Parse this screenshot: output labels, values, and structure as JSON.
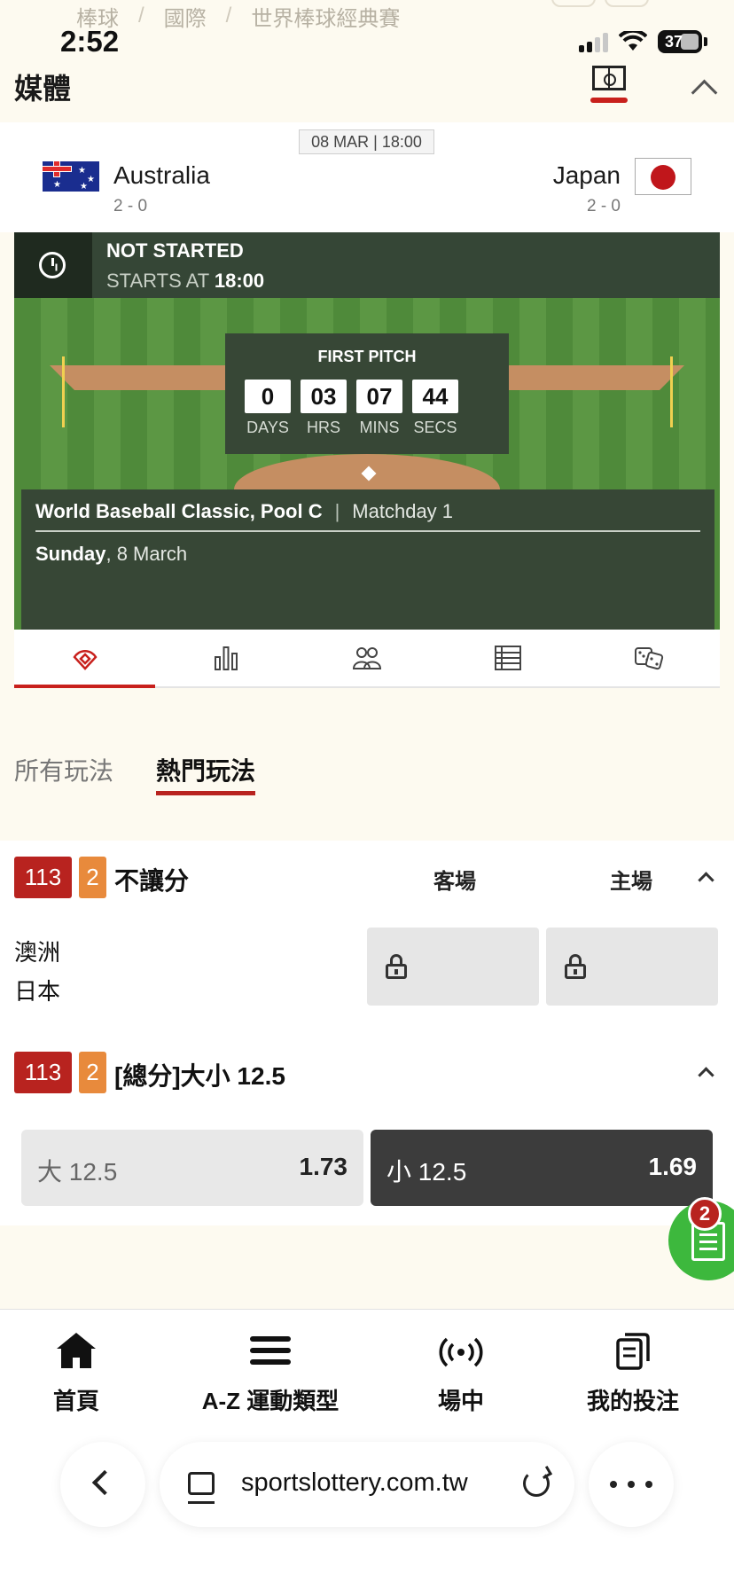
{
  "breadcrumb": [
    "棒球",
    "國際",
    "世界棒球經典賽"
  ],
  "status_bar": {
    "time": "2:52",
    "battery": "37"
  },
  "media": {
    "title": "媒體"
  },
  "match": {
    "date": "08 MAR | 18:00",
    "home": {
      "name": "Australia",
      "score": "2 - 0"
    },
    "away": {
      "name": "Japan",
      "score": "2 - 0"
    },
    "status": "NOT STARTED",
    "starts_at_label": "STARTS AT",
    "starts_at_time": "18:00",
    "first_pitch_label": "FIRST PITCH",
    "countdown": [
      {
        "value": "0",
        "unit": "DAYS"
      },
      {
        "value": "03",
        "unit": "HRS"
      },
      {
        "value": "07",
        "unit": "MINS"
      },
      {
        "value": "44",
        "unit": "SECS"
      }
    ],
    "competition": "World Baseball Classic, Pool C",
    "matchday": "Matchday 1",
    "day": "Sunday",
    "date_long": ", 8 March"
  },
  "icon_tabs": [
    "field-icon",
    "stats-icon",
    "lineups-icon",
    "standings-icon",
    "dice-icon"
  ],
  "play_tabs": {
    "all": "所有玩法",
    "popular": "熱門玩法"
  },
  "markets": {
    "moneyline": {
      "code": "113",
      "num": "2",
      "title": "不讓分",
      "col_away": "客場",
      "col_home": "主場",
      "team1": "澳洲",
      "team2": "日本"
    },
    "total": {
      "code": "113",
      "num": "2",
      "title": "[總分]大小 12.5",
      "over_label": "大 12.5",
      "over_odds": "1.73",
      "under_label": "小 12.5",
      "under_odds": "1.69"
    }
  },
  "betslip": {
    "count": "2"
  },
  "bottom_nav": {
    "home": "首頁",
    "sports": "A-Z 運動類型",
    "live": "場中",
    "my_bets": "我的投注"
  },
  "browser": {
    "url": "sportslottery.com.tw"
  },
  "colors": {
    "accent_red": "#b8231f",
    "badge_orange": "#e88a3c",
    "field_green": "#354636",
    "fab_green": "#3db83d"
  }
}
